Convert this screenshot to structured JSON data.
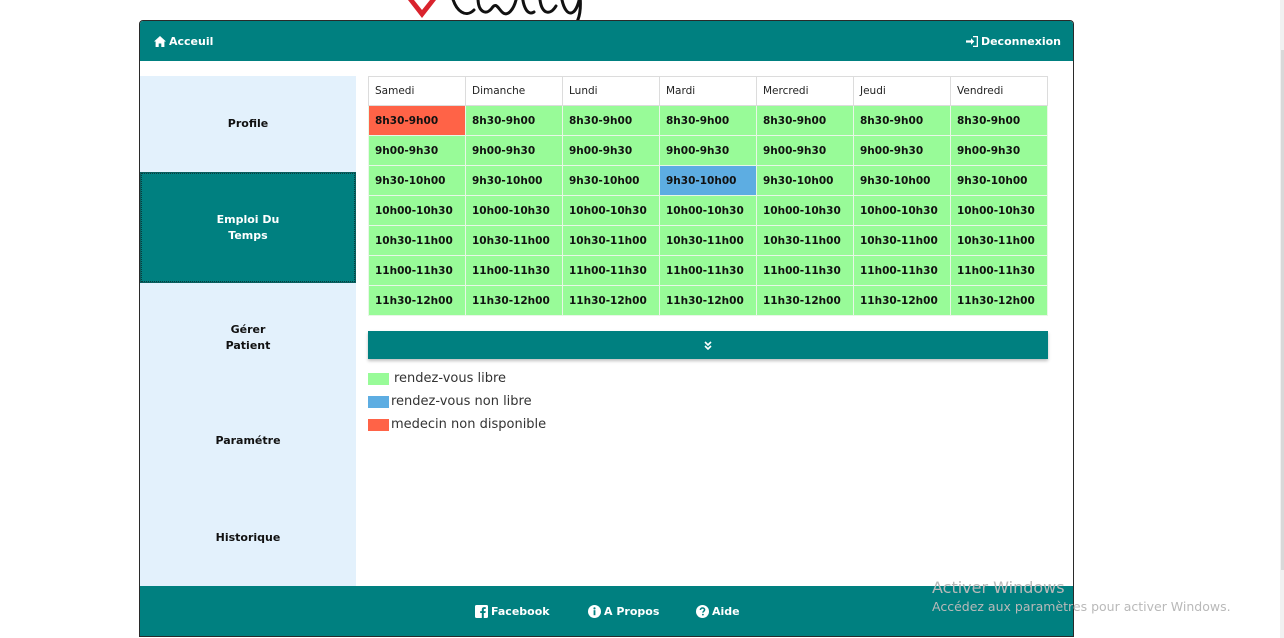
{
  "nav": {
    "home_label": "Acceuil",
    "logout_label": "Deconnexion",
    "home_icon": "home-icon",
    "logout_icon": "sign-out-icon"
  },
  "sidebar": {
    "items": [
      {
        "label": "Profile"
      },
      {
        "line1": "Emploi Du",
        "line2": "Temps",
        "active": true
      },
      {
        "line1": "Gérer",
        "line2": "Patient"
      },
      {
        "label": "Paramétre"
      },
      {
        "label": "Historique"
      }
    ]
  },
  "schedule": {
    "days": [
      "Samedi",
      "Dimanche",
      "Lundi",
      "Mardi",
      "Mercredi",
      "Jeudi",
      "Vendredi"
    ],
    "slots": [
      "8h30-9h00",
      "9h00-9h30",
      "9h30-10h00",
      "10h00-10h30",
      "10h30-11h00",
      "11h00-11h30",
      "11h30-12h00"
    ],
    "cell_status": [
      [
        "unavailable",
        "free",
        "free",
        "free",
        "free",
        "free",
        "free"
      ],
      [
        "free",
        "free",
        "free",
        "free",
        "free",
        "free",
        "free"
      ],
      [
        "free",
        "free",
        "free",
        "booked",
        "free",
        "free",
        "free"
      ],
      [
        "free",
        "free",
        "free",
        "free",
        "free",
        "free",
        "free"
      ],
      [
        "free",
        "free",
        "free",
        "free",
        "free",
        "free",
        "free"
      ],
      [
        "free",
        "free",
        "free",
        "free",
        "free",
        "free",
        "free"
      ],
      [
        "free",
        "free",
        "free",
        "free",
        "free",
        "free",
        "free"
      ]
    ]
  },
  "colors": {
    "primary": "#008080",
    "free": "#98fb98",
    "booked": "#5dade2",
    "unavailable": "#ff6347",
    "sidebar_bg": "#e3f1fc"
  },
  "expand_icon": "double-chevron-down-icon",
  "legend": [
    {
      "label": "rendez-vous libre",
      "status": "free"
    },
    {
      "label": "rendez-vous non libre",
      "status": "booked"
    },
    {
      "label": "medecin non disponible",
      "status": "unavailable"
    }
  ],
  "footer": {
    "facebook_label": "Facebook",
    "about_label": "A Propos",
    "help_label": "Aide",
    "facebook_icon": "facebook-icon",
    "about_icon": "info-circle-icon",
    "help_icon": "question-circle-icon"
  },
  "watermark": {
    "title": "Activer Windows",
    "subtitle": "Accédez aux paramètres pour activer Windows."
  }
}
